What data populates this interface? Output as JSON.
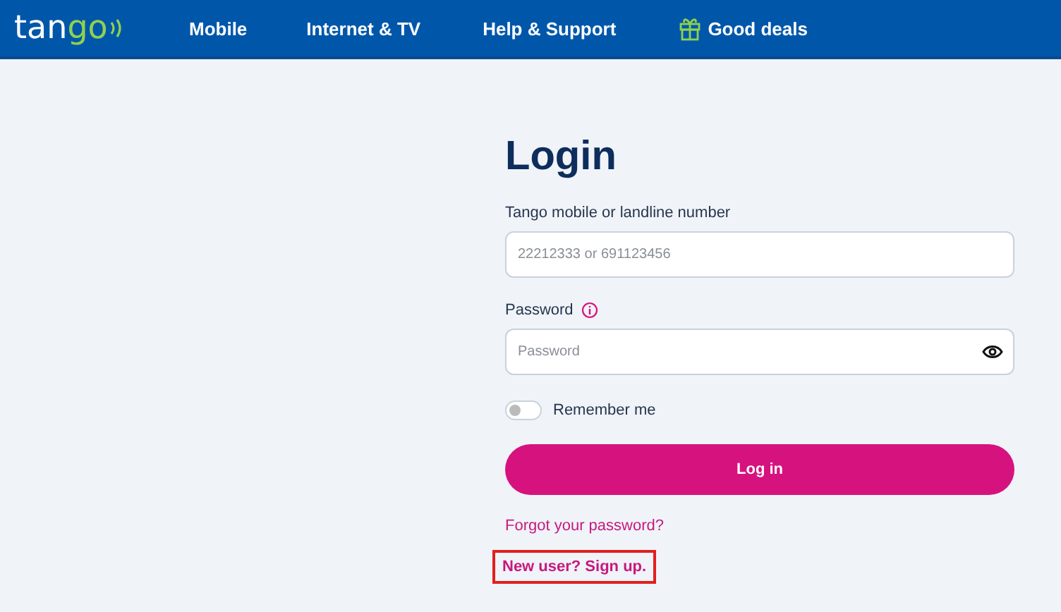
{
  "header": {
    "logo": {
      "part_1": "tan",
      "part_2": "go"
    },
    "nav": [
      {
        "label": "Mobile",
        "kind": "plain"
      },
      {
        "label": "Internet & TV",
        "kind": "plain"
      },
      {
        "label": "Help & Support",
        "kind": "plain"
      },
      {
        "label": "Good deals",
        "kind": "gift"
      }
    ]
  },
  "login": {
    "title": "Login",
    "number_field": {
      "label": "Tango mobile or landline number",
      "placeholder": "22212333 or 691123456"
    },
    "password_field": {
      "label": "Password",
      "placeholder": "Password"
    },
    "remember": {
      "label": "Remember me",
      "on": false
    },
    "button": "Log in",
    "forgot_link": "Forgot your password?",
    "signup_link": {
      "label": "New user? Sign up.",
      "highlighted": true
    }
  }
}
